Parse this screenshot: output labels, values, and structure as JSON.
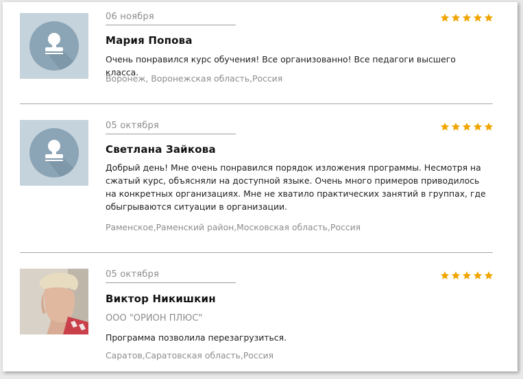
{
  "colors": {
    "star": "#f0a500",
    "avatar_bg": "#c5d3dc",
    "avatar_circle": "#8ba4b6"
  },
  "reviews": [
    {
      "date": "06 ноября",
      "name": "Мария Попова",
      "company": "",
      "text": "Очень понравился курс обучения! Все организованно! Все педагоги высшего класса.",
      "location": "Воронеж, Воронежская область,Россия",
      "rating": 5,
      "avatar_icon": "user-placeholder-icon"
    },
    {
      "date": "05 октября",
      "name": "Светлана Зайкова",
      "company": "",
      "text": "Добрый день! Мне очень понравился порядок изложения программы. Несмотря на сжатый курс, объясняли на доступной языке. Очень много примеров приводилось на конкретных организациях. Мне не хватило практических занятий в группах, где обыгрываются ситуации в организации.",
      "location": "Раменское,Раменский район,Московская область,Россия",
      "rating": 5,
      "avatar_icon": "user-placeholder-icon"
    },
    {
      "date": "05 октября",
      "name": "Виктор Никишкин",
      "company": "ООО \"ОРИОН ПЛЮС\"",
      "text": "Программа позволила перезагрузиться.",
      "location": "Саратов,Саратовская область,Россия",
      "rating": 5,
      "avatar_icon": "user-photo"
    }
  ]
}
